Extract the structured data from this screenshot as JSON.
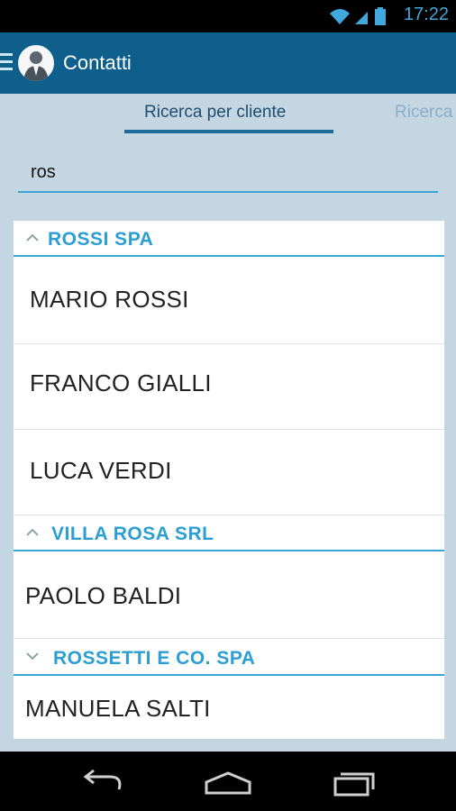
{
  "status": {
    "time": "17:22"
  },
  "app": {
    "title": "Contatti"
  },
  "tabs": [
    {
      "label": "Ricerca per cliente"
    },
    {
      "label": "Ricerca"
    }
  ],
  "search": {
    "value": "ros"
  },
  "groups": [
    {
      "name": "ROSSI SPA",
      "expanded": true,
      "contacts": [
        "MARIO ROSSI",
        "FRANCO GIALLI",
        "LUCA VERDI"
      ]
    },
    {
      "name": "VILLA ROSA SRL",
      "expanded": true,
      "contacts": [
        "PAOLO BALDI"
      ]
    },
    {
      "name": "ROSSETTI E CO. SPA",
      "expanded": false,
      "contacts": [
        "MANUELA SALTI"
      ]
    }
  ],
  "colors": {
    "action_bar": "#0f5f8d",
    "accent": "#2b9ed3",
    "background": "#c4d6e1"
  }
}
